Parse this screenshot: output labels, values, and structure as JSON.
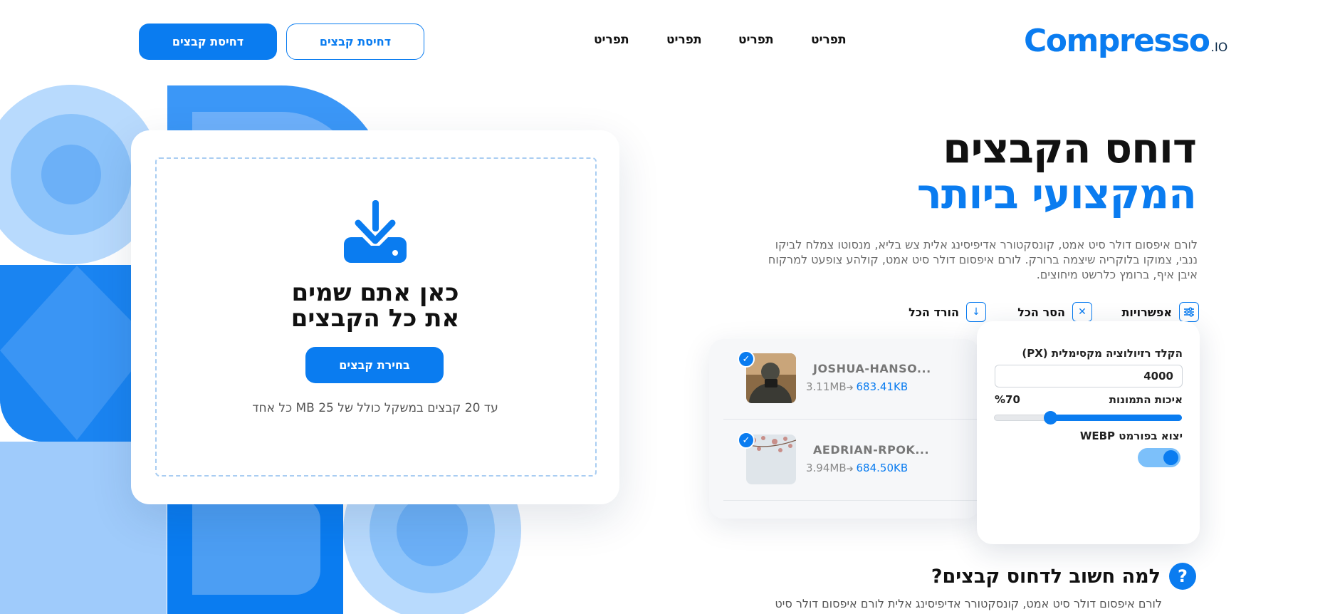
{
  "brand": {
    "name": "Compresso",
    "ext": ".IO",
    "color": "#0a7cf0"
  },
  "nav": {
    "links": [
      "תפריט",
      "תפריט",
      "תפריט",
      "תפריט"
    ]
  },
  "header": {
    "outline_button": "דחיסת קבצים",
    "primary_button": "דחיסת קבצים"
  },
  "upload": {
    "title_line1": "כאן אתם שמים",
    "title_line2": "את כל הקבצים",
    "choose_button": "בחירת קבצים",
    "note": "עד 20 קבצים במשקל כולל של 25 MB כל אחד",
    "icon": "download-tray-icon"
  },
  "hero": {
    "title_line1": "דוחס הקבצים",
    "title_line2": "המקצועי ביותר",
    "description": "לורם איפסום דולר סיט אמט, קונסקטורר אדיפיסינג אלית צש בליא, מנסוטו צמלח לביקו ננבי, צמוקו בלוקריה שיצמה ברורק. לורם איפסום דולר סיט אמט, קולהע צופעט למרקוח איבן איף, ברומץ כלרשט מיחוצים."
  },
  "toolbar": {
    "options": {
      "label": "אפשרויות",
      "icon": "sliders-icon"
    },
    "remove_all": {
      "label": "הסר הכל",
      "icon": "close-icon"
    },
    "download_all": {
      "label": "הורד הכל",
      "icon": "download-arrow-icon"
    }
  },
  "files": [
    {
      "name": "JOSHUA-HANSO...",
      "original_size": "3.11MB",
      "compressed_size": "683.41KB",
      "checked": true
    },
    {
      "name": "AEDRIAN-RPOK...",
      "original_size": "3.94MB",
      "compressed_size": "684.50KB",
      "checked": true
    }
  ],
  "options": {
    "resolution_label": "הקלד רזיולוציה מקסימלית (PX)",
    "resolution_value": "4000",
    "quality_label": "איכות התמונות",
    "quality_display": "%70",
    "quality_value": 0.7,
    "webp_label": "יצוא בפורמט WEBP",
    "webp_enabled": true
  },
  "why": {
    "title": "למה חשוב לדחוס קבצים?",
    "icon": "question-icon",
    "description": "לורם איפסום דולר סיט אמט, קונסקטורר אדיפיסינג אלית לורם איפסום דולר סיט"
  }
}
